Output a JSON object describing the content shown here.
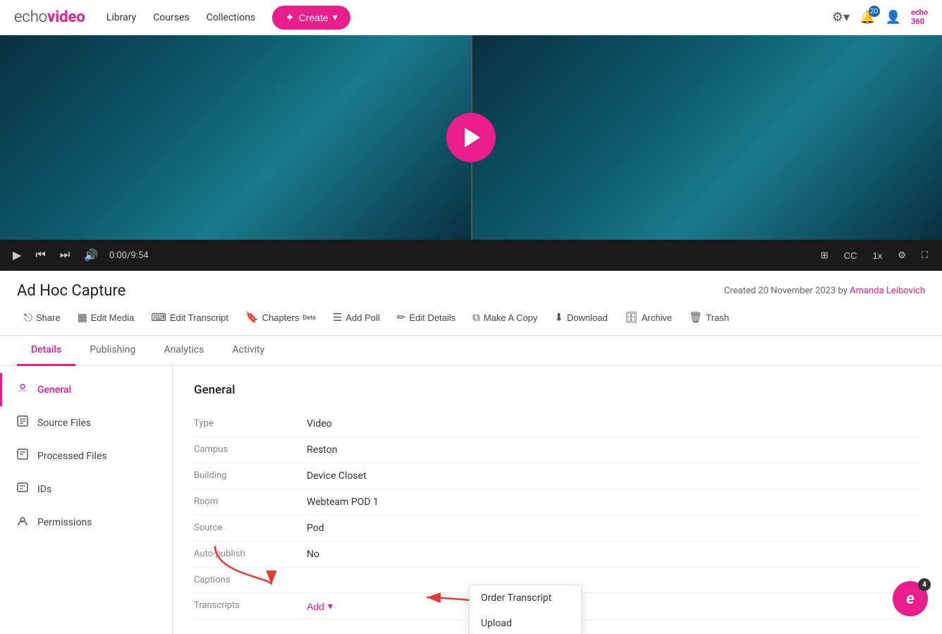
{
  "nav": {
    "logo_echo": "echo",
    "logo_video": "video",
    "links": [
      "Library",
      "Courses",
      "Collections"
    ],
    "create_label": "Create",
    "bell_badge": "20",
    "echo360_label": "echo\n360"
  },
  "video": {
    "time": "0:00/9:54",
    "play_label": "play"
  },
  "media": {
    "title": "Ad Hoc Capture",
    "created_info": "Created 20 November 2023 by",
    "created_by": "Amanda Leibovich"
  },
  "toolbar": {
    "share": "Share",
    "edit_media": "Edit Media",
    "edit_transcript": "Edit Transcript",
    "chapters": "Chapters",
    "chapters_badge": "Beta",
    "add_poll": "Add Poll",
    "edit_details": "Edit Details",
    "make_a_copy": "Make A Copy",
    "download": "Download",
    "archive": "Archive",
    "trash": "Trash"
  },
  "tabs": [
    "Details",
    "Publishing",
    "Analytics",
    "Activity"
  ],
  "active_tab": "Details",
  "sidebar": {
    "items": [
      {
        "id": "general",
        "label": "General",
        "icon": "⊙"
      },
      {
        "id": "source-files",
        "label": "Source Files",
        "icon": "⊞"
      },
      {
        "id": "processed-files",
        "label": "Processed Files",
        "icon": "⊟"
      },
      {
        "id": "ids",
        "label": "IDs",
        "icon": "⊡"
      },
      {
        "id": "permissions",
        "label": "Permissions",
        "icon": "🔑"
      }
    ],
    "active": "general"
  },
  "general": {
    "title": "General",
    "fields": [
      {
        "label": "Type",
        "value": "Video"
      },
      {
        "label": "Campus",
        "value": "Reston"
      },
      {
        "label": "Building",
        "value": "Device Closet"
      },
      {
        "label": "Room",
        "value": "Webteam POD 1"
      },
      {
        "label": "Source",
        "value": "Pod"
      },
      {
        "label": "Auto-publish",
        "value": "No"
      },
      {
        "label": "Captions",
        "value": ""
      },
      {
        "label": "Transcripts",
        "value": "Add"
      }
    ]
  },
  "transcript_dropdown": {
    "items": [
      "Order Transcript",
      "Upload"
    ]
  },
  "echo_fab": {
    "label": "e",
    "badge": "4"
  }
}
